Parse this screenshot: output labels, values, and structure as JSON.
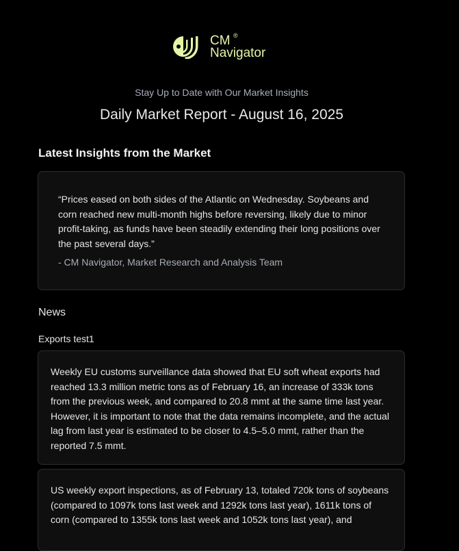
{
  "brand": {
    "name_line1": "CM",
    "name_line2": "Navigator",
    "registered_mark": "®",
    "color": "#e4f5a8"
  },
  "header": {
    "tagline": "Stay Up to Date with Our Market Insights",
    "title": "Daily Market Report - August 16, 2025"
  },
  "insights": {
    "heading": "Latest Insights from the Market",
    "quote": "“Prices eased on both sides of the Atlantic on Wednesday. Soybeans and corn reached new multi-month highs before reversing, likely due to minor profit-taking, as funds have been steadily extending their long positions over the past several days.”",
    "author": "- CM Navigator, Market Research and Analysis Team"
  },
  "news": {
    "heading": "News",
    "subheading": "Exports test1",
    "items": [
      {
        "text": "Weekly EU customs surveillance data showed that EU soft wheat exports had reached 13.3 million metric tons as of February 16, an increase of 333k tons from the previous week, and compared to 20.8 mmt at the same time last year. However, it is important to note that the data remains incomplete, and the actual lag from last year is estimated to be closer to 4.5–5.0 mmt, rather than the reported 7.5 mmt."
      },
      {
        "text": "US weekly export inspections, as of February 13, totaled 720k tons of soybeans (compared to 1097k tons last week and 1292k tons last year), 1611k tons of corn (compared to 1355k tons last week and 1052k tons last year), and"
      }
    ]
  },
  "colors": {
    "background": "#000000",
    "card_background": "#0f0f0f",
    "card_border": "#2c2c2c",
    "muted_text": "#a9aeb8"
  }
}
